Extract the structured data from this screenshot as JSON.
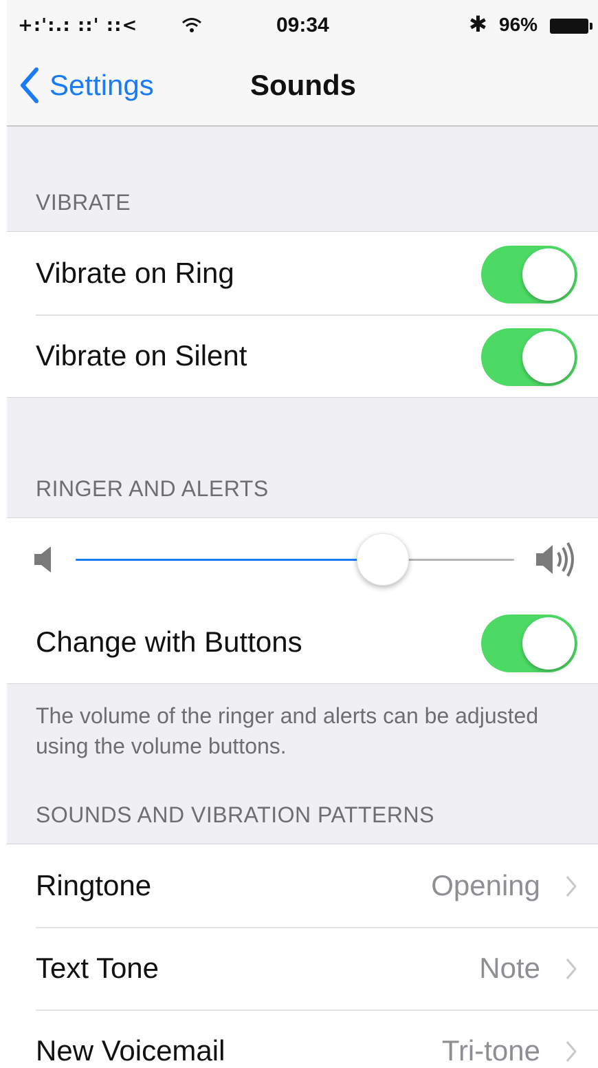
{
  "status_bar": {
    "carrier": "+:':.: ::' ::< ",
    "wifi_icon": "wifi-icon",
    "time": "09:34",
    "bluetooth_icon": "bluetooth-icon",
    "battery_percent": "96%",
    "battery_level": 0.96
  },
  "nav": {
    "back_label": "Settings",
    "title": "Sounds"
  },
  "vibrate": {
    "header": "VIBRATE",
    "rows": [
      {
        "label": "Vibrate on Ring",
        "on": true
      },
      {
        "label": "Vibrate on Silent",
        "on": true
      }
    ]
  },
  "ringer": {
    "header": "RINGER AND ALERTS",
    "volume_fraction": 0.7,
    "change_with_buttons": {
      "label": "Change with Buttons",
      "on": true
    },
    "footer": "The volume of the ringer and alerts can be adjusted using the volume buttons."
  },
  "sounds": {
    "header": "SOUNDS AND VIBRATION PATTERNS",
    "rows": [
      {
        "label": "Ringtone",
        "value": "Opening"
      },
      {
        "label": "Text Tone",
        "value": "Note"
      },
      {
        "label": "New Voicemail",
        "value": "Tri-tone"
      }
    ]
  },
  "colors": {
    "accent_blue": "#1a7cf4",
    "switch_on": "#4cd964",
    "background": "#efeff4"
  }
}
